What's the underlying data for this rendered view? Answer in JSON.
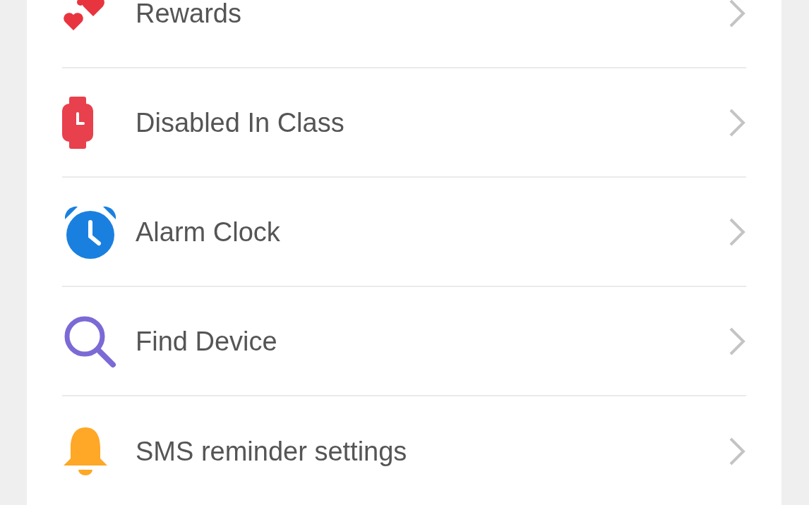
{
  "menu": [
    {
      "kind": "hearts",
      "label": "Rewards"
    },
    {
      "kind": "watch",
      "label": "Disabled In Class"
    },
    {
      "kind": "alarm",
      "label": "Alarm Clock"
    },
    {
      "kind": "search",
      "label": "Find Device"
    },
    {
      "kind": "bell",
      "label": "SMS reminder settings"
    }
  ]
}
